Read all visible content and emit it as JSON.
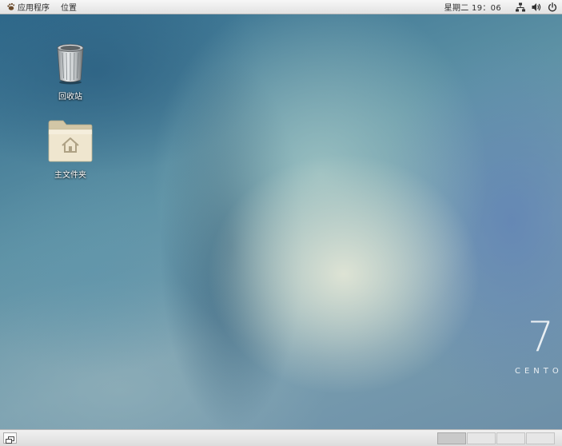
{
  "top_panel": {
    "applications_label": "应用程序",
    "places_label": "位置",
    "clock": "星期二 19：06",
    "icons": [
      "gnome-foot-icon",
      "network-icon",
      "volume-icon",
      "power-icon"
    ]
  },
  "desktop": {
    "icons": [
      {
        "label": "回收站",
        "icon": "trash-icon"
      },
      {
        "label": "主文件夹",
        "icon": "home-folder-icon"
      }
    ],
    "branding": {
      "number": "7",
      "name": "CENTOS"
    }
  },
  "bottom_panel": {
    "workspace_count": 4,
    "active_workspace": 1,
    "icons": [
      "show-desktop-icon"
    ]
  },
  "colors": {
    "panel": "#e9e9e9",
    "wallpaper_blue": "#2f6a8c",
    "wallpaper_light": "#e2e6d6"
  }
}
